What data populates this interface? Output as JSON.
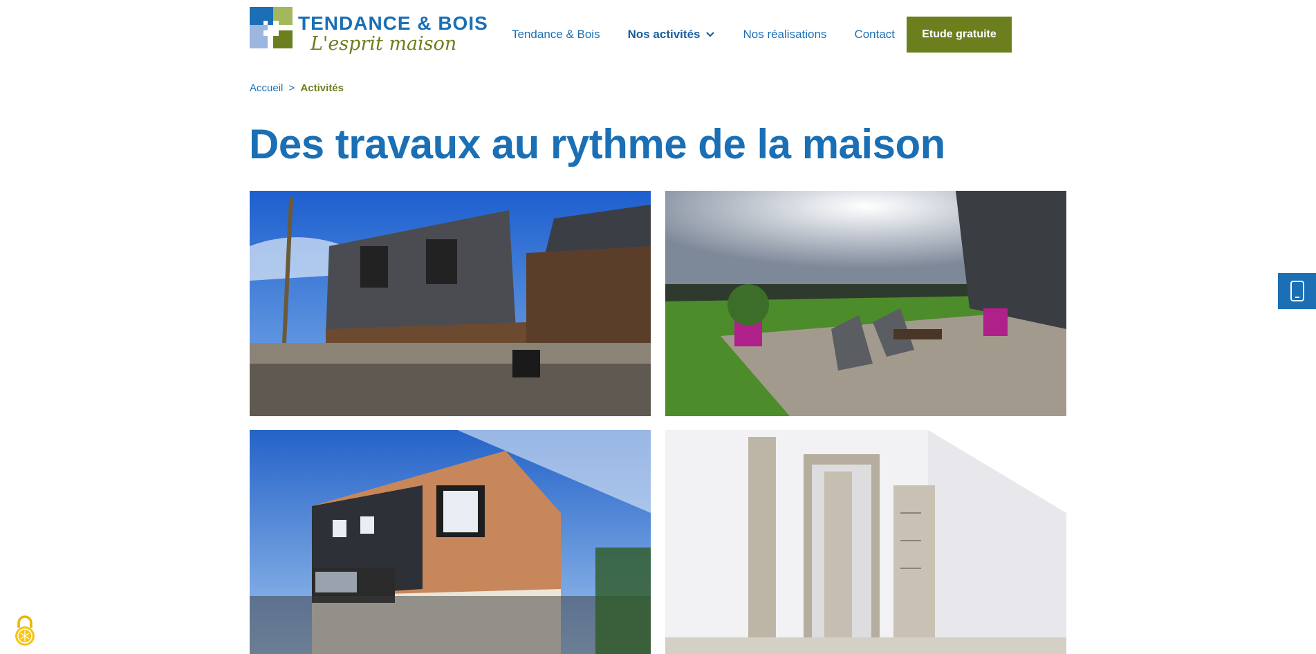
{
  "brand": {
    "name": "TENDANCE & BOIS",
    "tagline": "L'esprit maison",
    "colors": {
      "blue": "#1a6fb5",
      "green": "#6b7f1e",
      "light_blue": "#9cb6e0",
      "light_green": "#a3b85a"
    }
  },
  "nav": {
    "items": [
      {
        "label": "Tendance & Bois"
      },
      {
        "label": "Nos activités",
        "has_dropdown": true
      },
      {
        "label": "Nos réalisations"
      },
      {
        "label": "Contact"
      }
    ],
    "cta_label": "Etude gratuite"
  },
  "breadcrumb": {
    "home": "Accueil",
    "separator": ">",
    "current": "Activités"
  },
  "main": {
    "title": "Des travaux au rythme de la maison"
  },
  "icons": {
    "dropdown": "chevron-down-icon",
    "side_contact": "phone-icon",
    "cookie": "lock-icon"
  }
}
